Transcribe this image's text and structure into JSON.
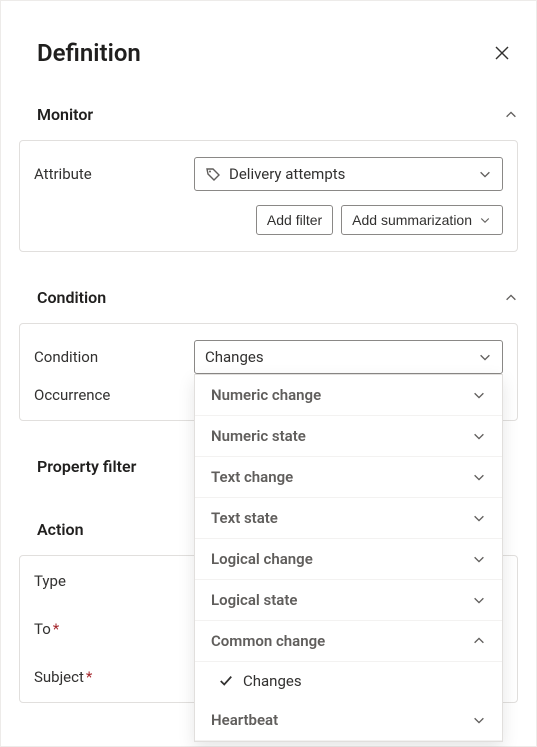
{
  "panel": {
    "title": "Definition"
  },
  "sections": {
    "monitor": {
      "title": "Monitor",
      "attribute_label": "Attribute",
      "attribute_value": "Delivery attempts",
      "add_filter": "Add filter",
      "add_summarization": "Add summarization"
    },
    "condition": {
      "title": "Condition",
      "condition_label": "Condition",
      "condition_value": "Changes",
      "occurrence_label": "Occurrence",
      "dropdown": {
        "groups": [
          {
            "label": "Numeric change",
            "expanded": false
          },
          {
            "label": "Numeric state",
            "expanded": false
          },
          {
            "label": "Text change",
            "expanded": false
          },
          {
            "label": "Text state",
            "expanded": false
          },
          {
            "label": "Logical change",
            "expanded": false
          },
          {
            "label": "Logical state",
            "expanded": false
          },
          {
            "label": "Common change",
            "expanded": true,
            "children": [
              {
                "label": "Changes",
                "selected": true
              }
            ]
          },
          {
            "label": "Heartbeat",
            "expanded": false
          }
        ]
      }
    },
    "property_filter": {
      "title": "Property filter"
    },
    "action": {
      "title": "Action",
      "type_label": "Type",
      "to_label": "To",
      "subject_label": "Subject"
    }
  }
}
